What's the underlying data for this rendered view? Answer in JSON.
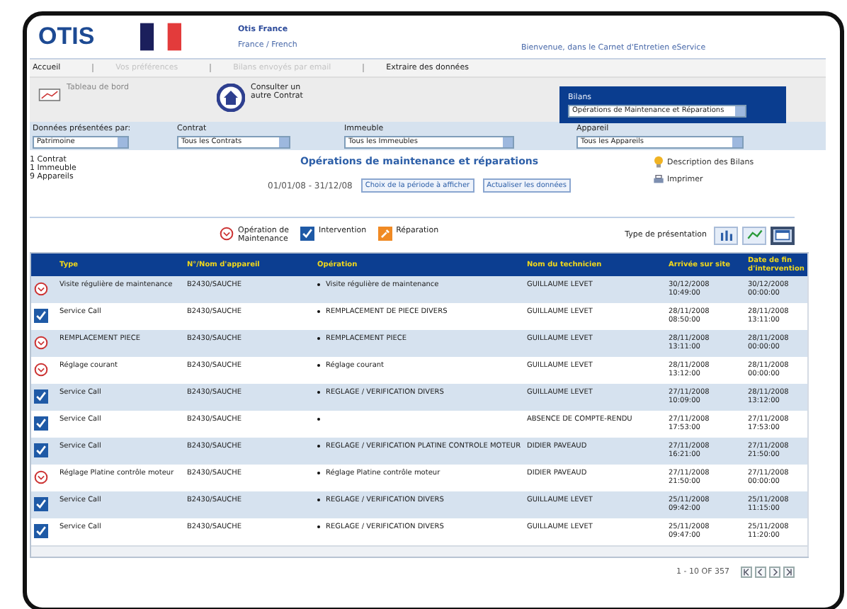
{
  "header": {
    "logo": "OTIS",
    "company": "Otis France",
    "language": "France / French",
    "welcome": "Bienvenue, dans le Carnet d'Entretien eService"
  },
  "nav": [
    {
      "label": "Accueil",
      "disabled": false
    },
    {
      "label": "Vos préférences",
      "disabled": true
    },
    {
      "label": "Bilans envoyés par email",
      "disabled": true
    },
    {
      "label": "Extraire des données",
      "disabled": false
    }
  ],
  "toolbar": {
    "dashboard": "Tableau de bord",
    "other_contract": "Consulter un autre Contrat",
    "bilans_label": "Bilans",
    "bilans_value": "Opérations de Maintenance et Réparations"
  },
  "filters": [
    {
      "label": "Données présentées par:",
      "value": "Patrimoine"
    },
    {
      "label": "Contrat",
      "value": "Tous les Contrats"
    },
    {
      "label": "Immeuble",
      "value": "Tous les Immeubles"
    },
    {
      "label": "Appareil",
      "value": "Tous les Appareils"
    }
  ],
  "summary": [
    "1 Contrat",
    "1 Immeuble",
    "9 Appareils"
  ],
  "report": {
    "title": "Opérations de maintenance et réparations",
    "period": "01/01/08 - 31/12/08",
    "buttons": [
      "Choix de la période à afficher",
      "Actualiser les données"
    ],
    "links": [
      {
        "kind": "bulb",
        "label": "Description des Bilans"
      },
      {
        "kind": "printer",
        "label": "Imprimer"
      }
    ]
  },
  "legend": [
    {
      "kind": "maintenance",
      "label": "Opération de Maintenance"
    },
    {
      "kind": "intervention",
      "label": "Intervention"
    },
    {
      "kind": "repair",
      "label": "Réparation"
    }
  ],
  "presentation": {
    "label": "Type de présentation",
    "views": [
      {
        "kind": "bar",
        "selected": false
      },
      {
        "kind": "line",
        "selected": false
      },
      {
        "kind": "table",
        "selected": true
      }
    ]
  },
  "table": {
    "columns": [
      "Type",
      "N°/Nom d'appareil",
      "Opération",
      "Nom du technicien",
      "Arrivée sur site",
      "Date de fin d'intervention"
    ],
    "rows": [
      {
        "kind": "maintenance",
        "type": "Visite régulière de maintenance",
        "device": "B2430/SAUCHE",
        "operation": "Visite régulière de maintenance",
        "technician": "GUILLAUME LEVET",
        "arrival": "30/12/2008 10:49:00",
        "end": "30/12/2008 00:00:00"
      },
      {
        "kind": "intervention",
        "type": "Service Call",
        "device": "B2430/SAUCHE",
        "operation": "REMPLACEMENT DE PIECE DIVERS",
        "technician": "GUILLAUME LEVET",
        "arrival": "28/11/2008 08:50:00",
        "end": "28/11/2008 13:11:00"
      },
      {
        "kind": "maintenance",
        "type": "REMPLACEMENT PIECE",
        "device": "B2430/SAUCHE",
        "operation": "REMPLACEMENT PIECE",
        "technician": "GUILLAUME LEVET",
        "arrival": "28/11/2008 13:11:00",
        "end": "28/11/2008 00:00:00"
      },
      {
        "kind": "maintenance",
        "type": "Réglage courant",
        "device": "B2430/SAUCHE",
        "operation": "Réglage courant",
        "technician": "GUILLAUME LEVET",
        "arrival": "28/11/2008 13:12:00",
        "end": "28/11/2008 00:00:00"
      },
      {
        "kind": "intervention",
        "type": "Service Call",
        "device": "B2430/SAUCHE",
        "operation": "REGLAGE / VERIFICATION DIVERS",
        "technician": "GUILLAUME LEVET",
        "arrival": "27/11/2008 10:09:00",
        "end": "28/11/2008 13:12:00"
      },
      {
        "kind": "intervention",
        "type": "Service Call",
        "device": "B2430/SAUCHE",
        "technician": "ABSENCE DE COMPTE-RENDU",
        "arrival": "27/11/2008 17:53:00",
        "end": "27/11/2008 17:53:00"
      },
      {
        "kind": "intervention",
        "type": "Service Call",
        "device": "B2430/SAUCHE",
        "operation": "REGLAGE / VERIFICATION PLATINE CONTROLE MOTEUR",
        "technician": "DIDIER PAVEAUD",
        "arrival": "27/11/2008 16:21:00",
        "end": "27/11/2008 21:50:00"
      },
      {
        "kind": "maintenance",
        "type": "Réglage Platine contrôle moteur",
        "device": "B2430/SAUCHE",
        "operation": "Réglage Platine contrôle moteur",
        "technician": "DIDIER PAVEAUD",
        "arrival": "27/11/2008 21:50:00",
        "end": "27/11/2008 00:00:00"
      },
      {
        "kind": "intervention",
        "type": "Service Call",
        "device": "B2430/SAUCHE",
        "operation": "REGLAGE / VERIFICATION DIVERS",
        "technician": "GUILLAUME LEVET",
        "arrival": "25/11/2008 09:42:00",
        "end": "25/11/2008 11:15:00"
      },
      {
        "kind": "intervention",
        "type": "Service Call",
        "device": "B2430/SAUCHE",
        "operation": "REGLAGE / VERIFICATION DIVERS",
        "technician": "GUILLAUME LEVET",
        "arrival": "25/11/2008 09:47:00",
        "end": "25/11/2008 11:20:00"
      }
    ]
  },
  "pagination": {
    "range": "1 - 10 OF 357"
  }
}
